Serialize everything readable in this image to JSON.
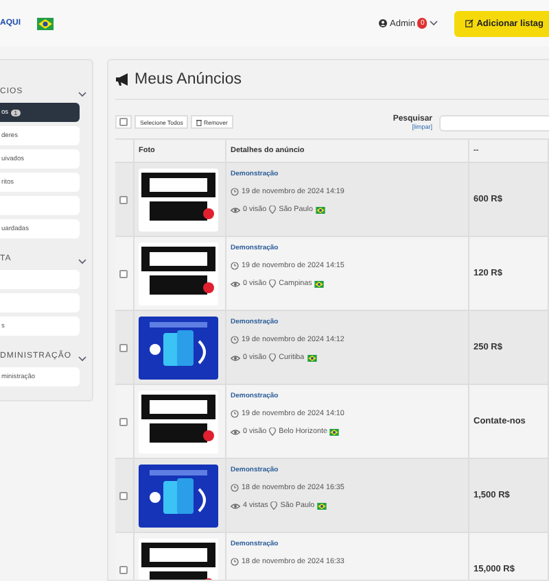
{
  "header": {
    "logo": "AQUI",
    "user": {
      "name": "Admin",
      "badge": "0"
    },
    "add_button": "Adicionar listag"
  },
  "sidebar": {
    "sections": [
      {
        "title": "CIOS",
        "expanded": true,
        "items": [
          {
            "label": "os",
            "badge": "1",
            "selected": true
          },
          {
            "label": "deres",
            "selected": false
          },
          {
            "label": "uivados",
            "selected": false
          },
          {
            "label": "ritos",
            "selected": false
          },
          {
            "selected": false
          },
          {
            "label": "uardadas",
            "selected": false
          }
        ]
      },
      {
        "title": "TA",
        "expanded": true,
        "items": [
          {
            "selected": false
          },
          {
            "selected": false
          },
          {
            "label": "s",
            "selected": false
          }
        ]
      },
      {
        "title": "DMINISTRAÇÃO",
        "expanded": true,
        "items": [
          {
            "label": "ministração",
            "selected": false
          }
        ]
      }
    ]
  },
  "main": {
    "title": "Meus Anúncios",
    "select_all_checked": false,
    "select_all": "Selecione Todos",
    "remove": "Remover",
    "search_label": "Pesquisar",
    "clear": "[limpar]",
    "table": {
      "columns": [
        "Foto",
        "Detalhes do anúncio",
        "--"
      ],
      "rows": [
        {
          "checked": false,
          "kind": "sale",
          "title": "Demonstração",
          "date": "19 de novembro de 2024 14:19",
          "views": "0 visão",
          "city": "São Paulo",
          "price": "600 R$"
        },
        {
          "checked": false,
          "kind": "sale",
          "title": "Demonstração",
          "date": "19 de novembro de 2024 14:15",
          "views": "0 visão",
          "city": "Campinas",
          "price": "120 R$"
        },
        {
          "checked": false,
          "kind": "phone",
          "title": "Demonstração",
          "date": "19 de novembro de 2024 14:12",
          "views": "0 visão",
          "city": "Curitiba",
          "price": "250 R$"
        },
        {
          "checked": false,
          "kind": "sale",
          "title": "Demonstração",
          "date": "19 de novembro de 2024 14:10",
          "views": "0 visão",
          "city": "Belo Horizonte",
          "price": "Contate-nos"
        },
        {
          "checked": false,
          "kind": "phone",
          "title": "Demonstração",
          "date": "18 de novembro de 2024 16:35",
          "views": "4 vistas",
          "city": "São Paulo",
          "price": "1,500 R$"
        },
        {
          "checked": false,
          "kind": "sale",
          "title": "Demonstração",
          "date": "18 de novembro de 2024 16:33",
          "price": "15,000 R$"
        }
      ]
    }
  }
}
